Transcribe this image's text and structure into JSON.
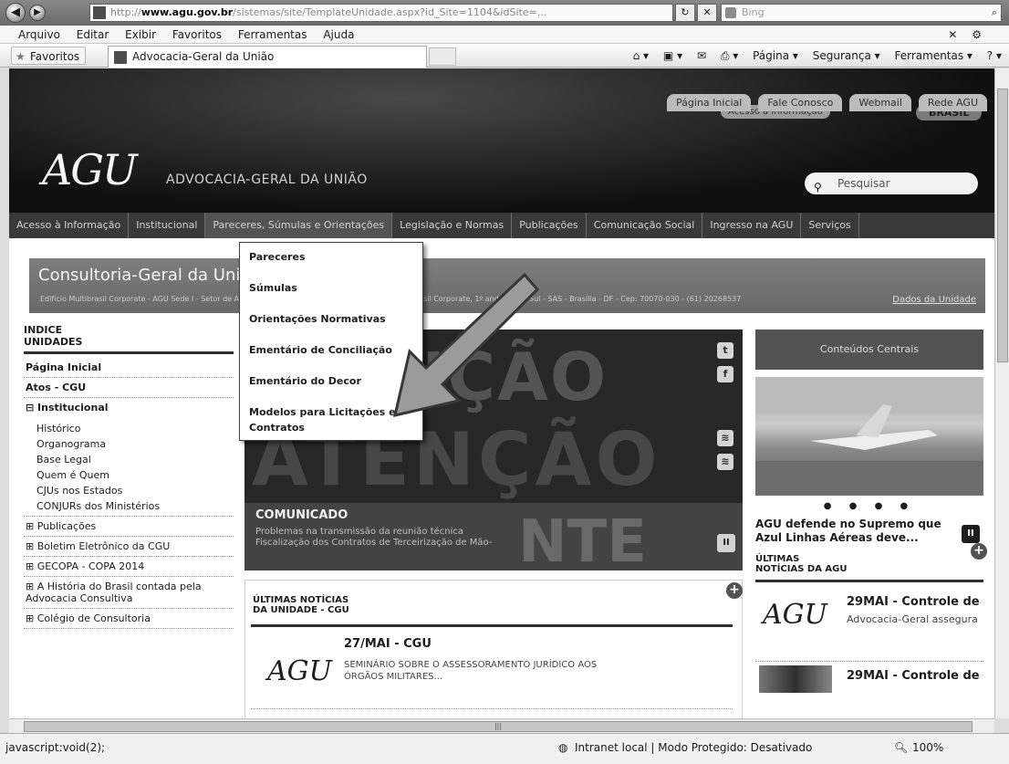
{
  "browser": {
    "address_domain": "www.agu.gov.br",
    "address_prefix": "http://",
    "address_path": "/sistemas/site/TemplateUnidade.aspx?id_Site=1104&idSite=...",
    "search_placeholder": "Bing",
    "menu": [
      "Arquivo",
      "Editar",
      "Exibir",
      "Favoritos",
      "Ferramentas",
      "Ajuda"
    ],
    "favorites_label": "Favoritos",
    "tab_title": "Advocacia-Geral da União",
    "commands": [
      "Página ▾",
      "Segurança ▾",
      "Ferramentas ▾"
    ],
    "status_left": "javascript:void(2);",
    "status_zone": "Intranet local | Modo Protegido: Desativado",
    "zoom": "100%"
  },
  "header": {
    "links": [
      "Página Inicial",
      "Fale Conosco",
      "Webmail",
      "Rede AGU"
    ],
    "acesso": "Acesso à Informação",
    "brasil": "BRASIL",
    "logo": "AGU",
    "site_name": "ADVOCACIA-GERAL DA UNIÃO",
    "search_label": "Pesquisar"
  },
  "nav": [
    "Acesso à Informação",
    "Institucional",
    "Pareceres, Súmulas e Orientações",
    "Legislação e Normas",
    "Publicações",
    "Comunicação Social",
    "Ingresso na AGU",
    "Serviços"
  ],
  "unit": {
    "title": "Consultoria-Geral da União",
    "address": "Edifício Multibrasil Corporate - AGU Sede I - Setor de Autarquias Sul, Quadra 3, Lote 5/6, Edifício Multibrasil Corporate, 1º andar - Asa Sul - SAS - Brasília - DF - Cep: 70070-030 - (61) 20268537",
    "data_link": "Dados da Unidade"
  },
  "dropdown": [
    "Pareceres",
    "Súmulas",
    "Orientações Normativas",
    "Ementário de Conciliação",
    "Ementário do Decor",
    "Modelos para Licitações e Contratos"
  ],
  "sidebar": {
    "heading1": "INDICE",
    "heading2": "UNIDADES",
    "page_home": "Página Inicial",
    "atos": "Atos - CGU",
    "institucional": "⊟ Institucional",
    "sub": [
      "Histórico",
      "Organograma",
      "Base Legal",
      "Quem é Quem",
      "CJUs nos Estados",
      "CONJURs dos Ministérios"
    ],
    "more": [
      "⊞ Publicações",
      "⊞ Boletim Eletrônico da CGU",
      "⊞ GECOPA - COPA 2014",
      "⊞ A História do Brasil contada pela Advocacia Consultiva",
      "⊞ Colégio de Consultoria"
    ]
  },
  "banner": {
    "bg1": "NÇÃO",
    "bg2": "ATENÇÃO",
    "bg3": "NTE",
    "caption": "COMUNICADO",
    "line1": "Problemas na transmissão da reunião técnica",
    "line2": "Fiscalização dos Contratos de Terceirização de Mão-",
    "pause": "II"
  },
  "right": {
    "header": "Conteúdos Centrais",
    "dots": "● ● ● ●",
    "caption": "AGU defende no Supremo que Azul Linhas Aéreas deve...",
    "pause": "II",
    "news_heading1": "ÚLTIMAS",
    "news_heading2": "NOTÍCIAS DA AGU",
    "news1_title": "29MAI - Controle de",
    "news1_sub": "Advocacia-Geral assegura",
    "news2_title": "29MAI - Controle de"
  },
  "center_news": {
    "heading1": "ÚLTIMAS NOTÍCIAS",
    "heading2": "DA UNIDADE - CGU",
    "date": "27/MAI - CGU",
    "text": "SEMINÁRIO SOBRE O ASSESSORAMENTO JURÍDICO AOS ÓRGÃOS MILITARES..."
  }
}
